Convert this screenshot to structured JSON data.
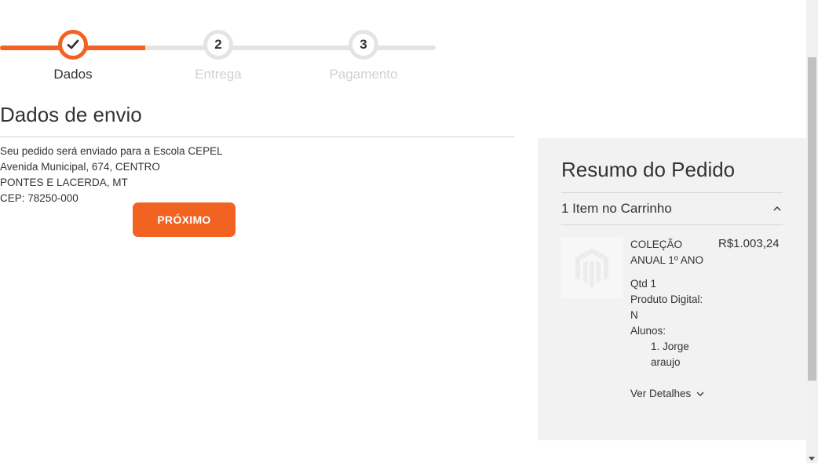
{
  "progress": {
    "steps": [
      {
        "number": "1",
        "label": "Dados",
        "status": "completed"
      },
      {
        "number": "2",
        "label": "Entrega",
        "status": "pending"
      },
      {
        "number": "3",
        "label": "Pagamento",
        "status": "pending"
      }
    ],
    "accent_color": "#f26322"
  },
  "shipping": {
    "title": "Dados de envio",
    "lines": [
      "Seu pedido será enviado para a Escola CEPEL",
      "Avenida Municipal, 674, CENTRO",
      "PONTES E LACERDA, MT",
      "CEP: 78250-000"
    ],
    "next_button": "PRÓXIMO"
  },
  "summary": {
    "title": "Resumo do Pedido",
    "cart_toggle": "1 Item no Carrinho",
    "item": {
      "image_icon": "magento-logo-icon",
      "name": "COLEÇÃO ANUAL 1º ANO",
      "price": "R$1.003,24",
      "qty": "Qtd 1",
      "digital_label": "Produto Digital:",
      "digital_value": "N",
      "students_label": "Alunos:",
      "students": [
        "1. Jorge araujo"
      ],
      "details_link": "Ver Detalhes"
    }
  }
}
